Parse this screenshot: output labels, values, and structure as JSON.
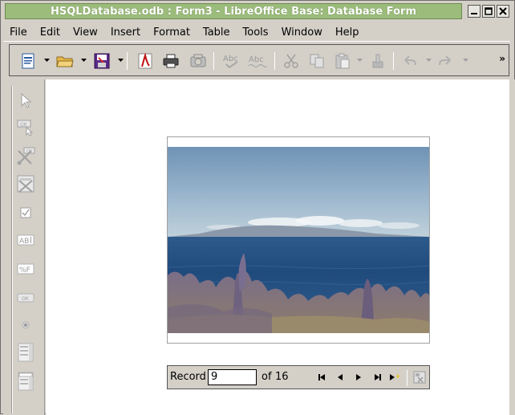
{
  "window": {
    "title": "HSQLDatabase.odb : Form3 - LibreOffice Base: Database Form"
  },
  "menubar": {
    "items": [
      "File",
      "Edit",
      "View",
      "Insert",
      "Format",
      "Table",
      "Tools",
      "Window",
      "Help"
    ]
  },
  "toolbar": {
    "overflow_label": "»",
    "spell_label": "Abc",
    "autospell_label": "Abc"
  },
  "form_controls": {
    "text_box_label": "AB",
    "formatted_label": "%F",
    "button_label": "OK"
  },
  "navigation": {
    "record_label": "Record",
    "record_value": "9",
    "of_label": "of",
    "total": "16"
  },
  "colors": {
    "title_bar": "#9cbc7c",
    "chrome": "#d4d0c8",
    "canvas": "#ffffff"
  }
}
